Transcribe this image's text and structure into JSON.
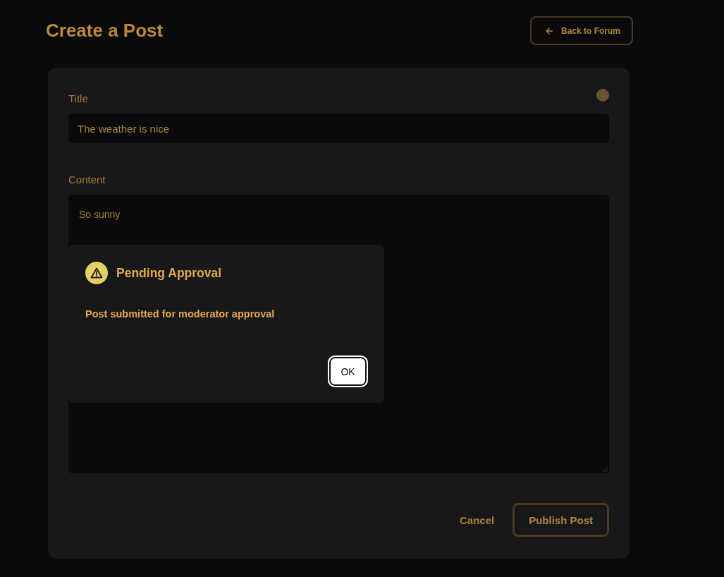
{
  "page": {
    "title": "Create a Post",
    "back_button": "Back to Forum"
  },
  "form": {
    "fields": [
      {
        "kind": "input",
        "label": "Title",
        "value": "The weather is nice"
      },
      {
        "kind": "textarea",
        "label": "Content",
        "value": "So sunny"
      }
    ],
    "buttons": [
      {
        "kind": "text",
        "label": "Cancel"
      },
      {
        "kind": "outlined",
        "label": "Publish Post"
      }
    ]
  },
  "dialog": {
    "title": "Pending Approval",
    "message": "Post submitted for moderator approval",
    "buttons": [
      "OK"
    ]
  }
}
